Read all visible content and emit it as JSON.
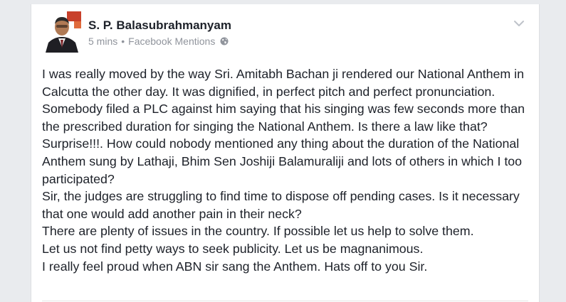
{
  "post": {
    "author": "S. P. Balasubrahmanyam",
    "timestamp": "5 mins",
    "separator": "•",
    "source": "Facebook Mentions",
    "privacy_icon": "globe-icon",
    "menu_icon": "chevron-down-icon",
    "paragraphs": [
      "I was really moved by the way Sri. Amitabh Bachan ji rendered our National Anthem in Calcutta the other day. It was dignified, in perfect pitch and perfect pronunciation.",
      "Somebody filed a PLC against him saying that his singing was few seconds more than the prescribed duration for singing the National Anthem. Is there a law like that? Surprise!!!. How could nobody mentioned any thing about the duration of the National Anthem  sung by Lathaji, Bhim Sen Joshiji Balamuraliji and lots of others in which I too participated?",
      "Sir, the judges are struggling to find time to dispose off pending cases. Is it necessary that one would add another pain in their neck?",
      "There are plenty of issues in the country. If possible let us help to solve them.",
      "Let us not find petty ways to seek publicity. Let us be magnanimous.",
      "I really feel proud when ABN sir sang the Anthem. Hats off to you Sir."
    ]
  },
  "colors": {
    "page_background": "#e9ebee",
    "card_background": "#ffffff",
    "text_primary": "#1d2129",
    "text_secondary": "#90949c"
  }
}
